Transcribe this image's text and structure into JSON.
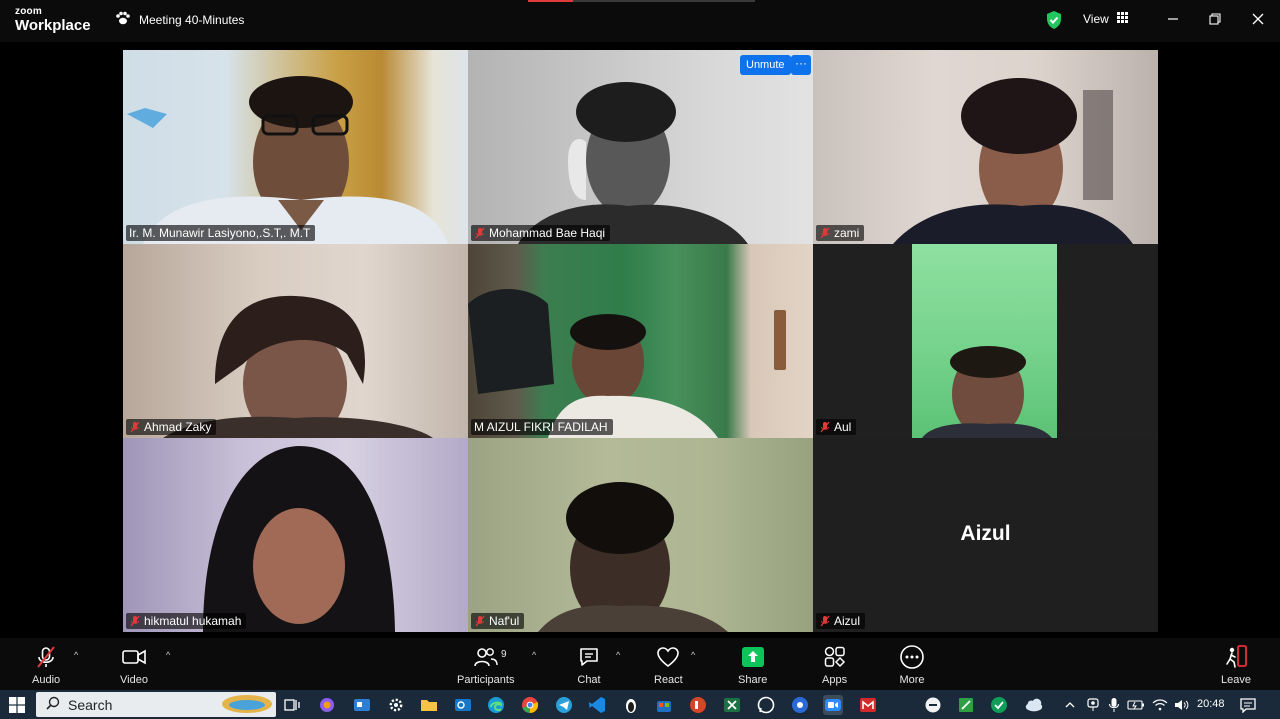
{
  "app": {
    "logo_line1": "zoom",
    "logo_line2": "Workplace",
    "meeting_title": "Meeting 40-Minutes",
    "view_label": "View"
  },
  "tiles": [
    {
      "name": "Ir. M. Munawir Lasiyono,.S.T,. M.T",
      "muted": false,
      "active": true
    },
    {
      "name": "Mohammad Bae Haqi",
      "muted": true,
      "active": false
    },
    {
      "name": "zami",
      "muted": true,
      "active": false
    },
    {
      "name": "Ahmad Zaky",
      "muted": true,
      "active": false
    },
    {
      "name": "M AIZUL FIKRI FADILAH",
      "muted": false,
      "active": false
    },
    {
      "name": "Aul",
      "muted": true,
      "active": false
    },
    {
      "name": "hikmatul hukamah",
      "muted": true,
      "active": false
    },
    {
      "name": "Naf'ul",
      "muted": true,
      "active": false
    },
    {
      "name": "Aizul",
      "muted": true,
      "active": false,
      "video_off_name": "Aizul"
    }
  ],
  "tile_actions": {
    "unmute_label": "Unmute",
    "more_label": "···"
  },
  "toolbar": {
    "audio": "Audio",
    "video": "Video",
    "participants": "Participants",
    "participants_count": "9",
    "chat": "Chat",
    "react": "React",
    "share": "Share",
    "apps": "Apps",
    "more": "More",
    "leave": "Leave"
  },
  "taskbar": {
    "search_placeholder": "Search",
    "time": "20:48"
  },
  "colors": {
    "active_speaker": "#3fd17a",
    "unmute_button": "#0e72ed",
    "muted_mic": "#e03a3a",
    "share_green": "#0dc45a",
    "leave_red": "#e5303a"
  }
}
